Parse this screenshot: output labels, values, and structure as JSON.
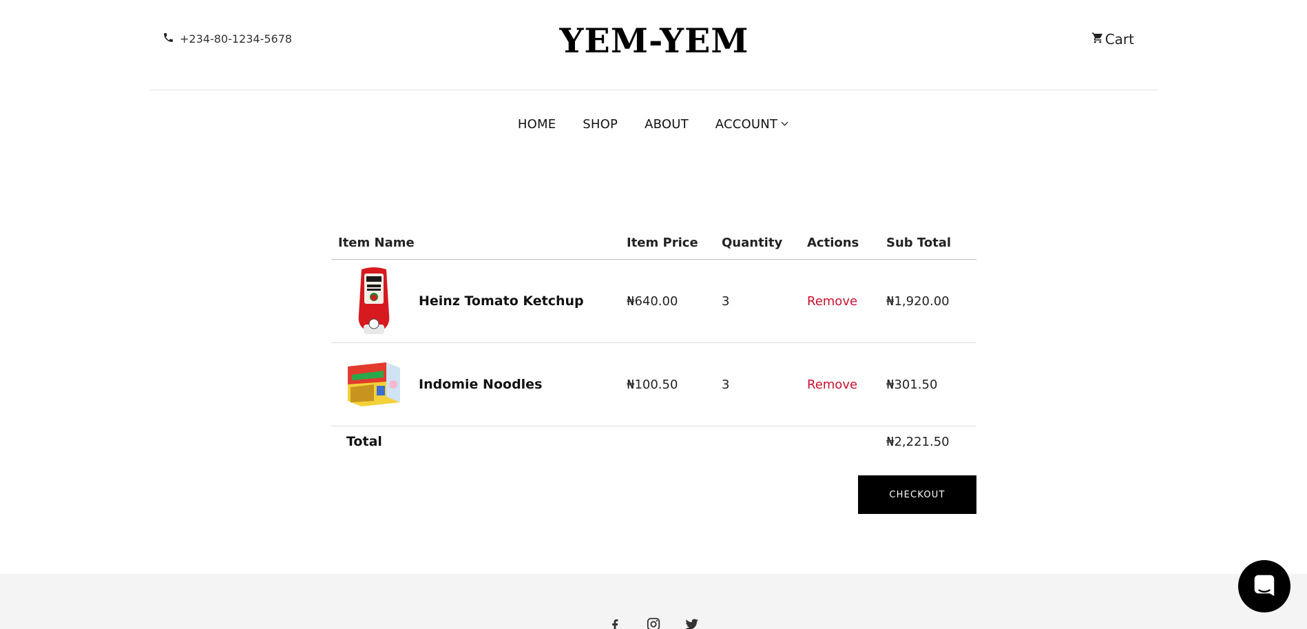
{
  "header": {
    "phone": "+234-80-1234-5678",
    "logo": "YEM-YEM",
    "cart_label": "Cart"
  },
  "nav": {
    "items": [
      "HOME",
      "SHOP",
      "ABOUT",
      "ACCOUNT"
    ]
  },
  "table": {
    "columns": [
      "Item Name",
      "Item Price",
      "Quantity",
      "Actions",
      "Sub Total"
    ],
    "rows": [
      {
        "name": "Heinz Tomato Ketchup",
        "price": "₦640.00",
        "quantity": "3",
        "action": "Remove",
        "subtotal": "₦1,920.00"
      },
      {
        "name": "Indomie Noodles",
        "price": "₦100.50",
        "quantity": "3",
        "action": "Remove",
        "subtotal": "₦301.50"
      }
    ],
    "total_label": "Total",
    "total_value": "₦2,221.50"
  },
  "checkout_label": "CHECKOUT",
  "colors": {
    "remove": "#c8102e",
    "button": "#000000",
    "footer_bg": "#f4f4f4"
  }
}
